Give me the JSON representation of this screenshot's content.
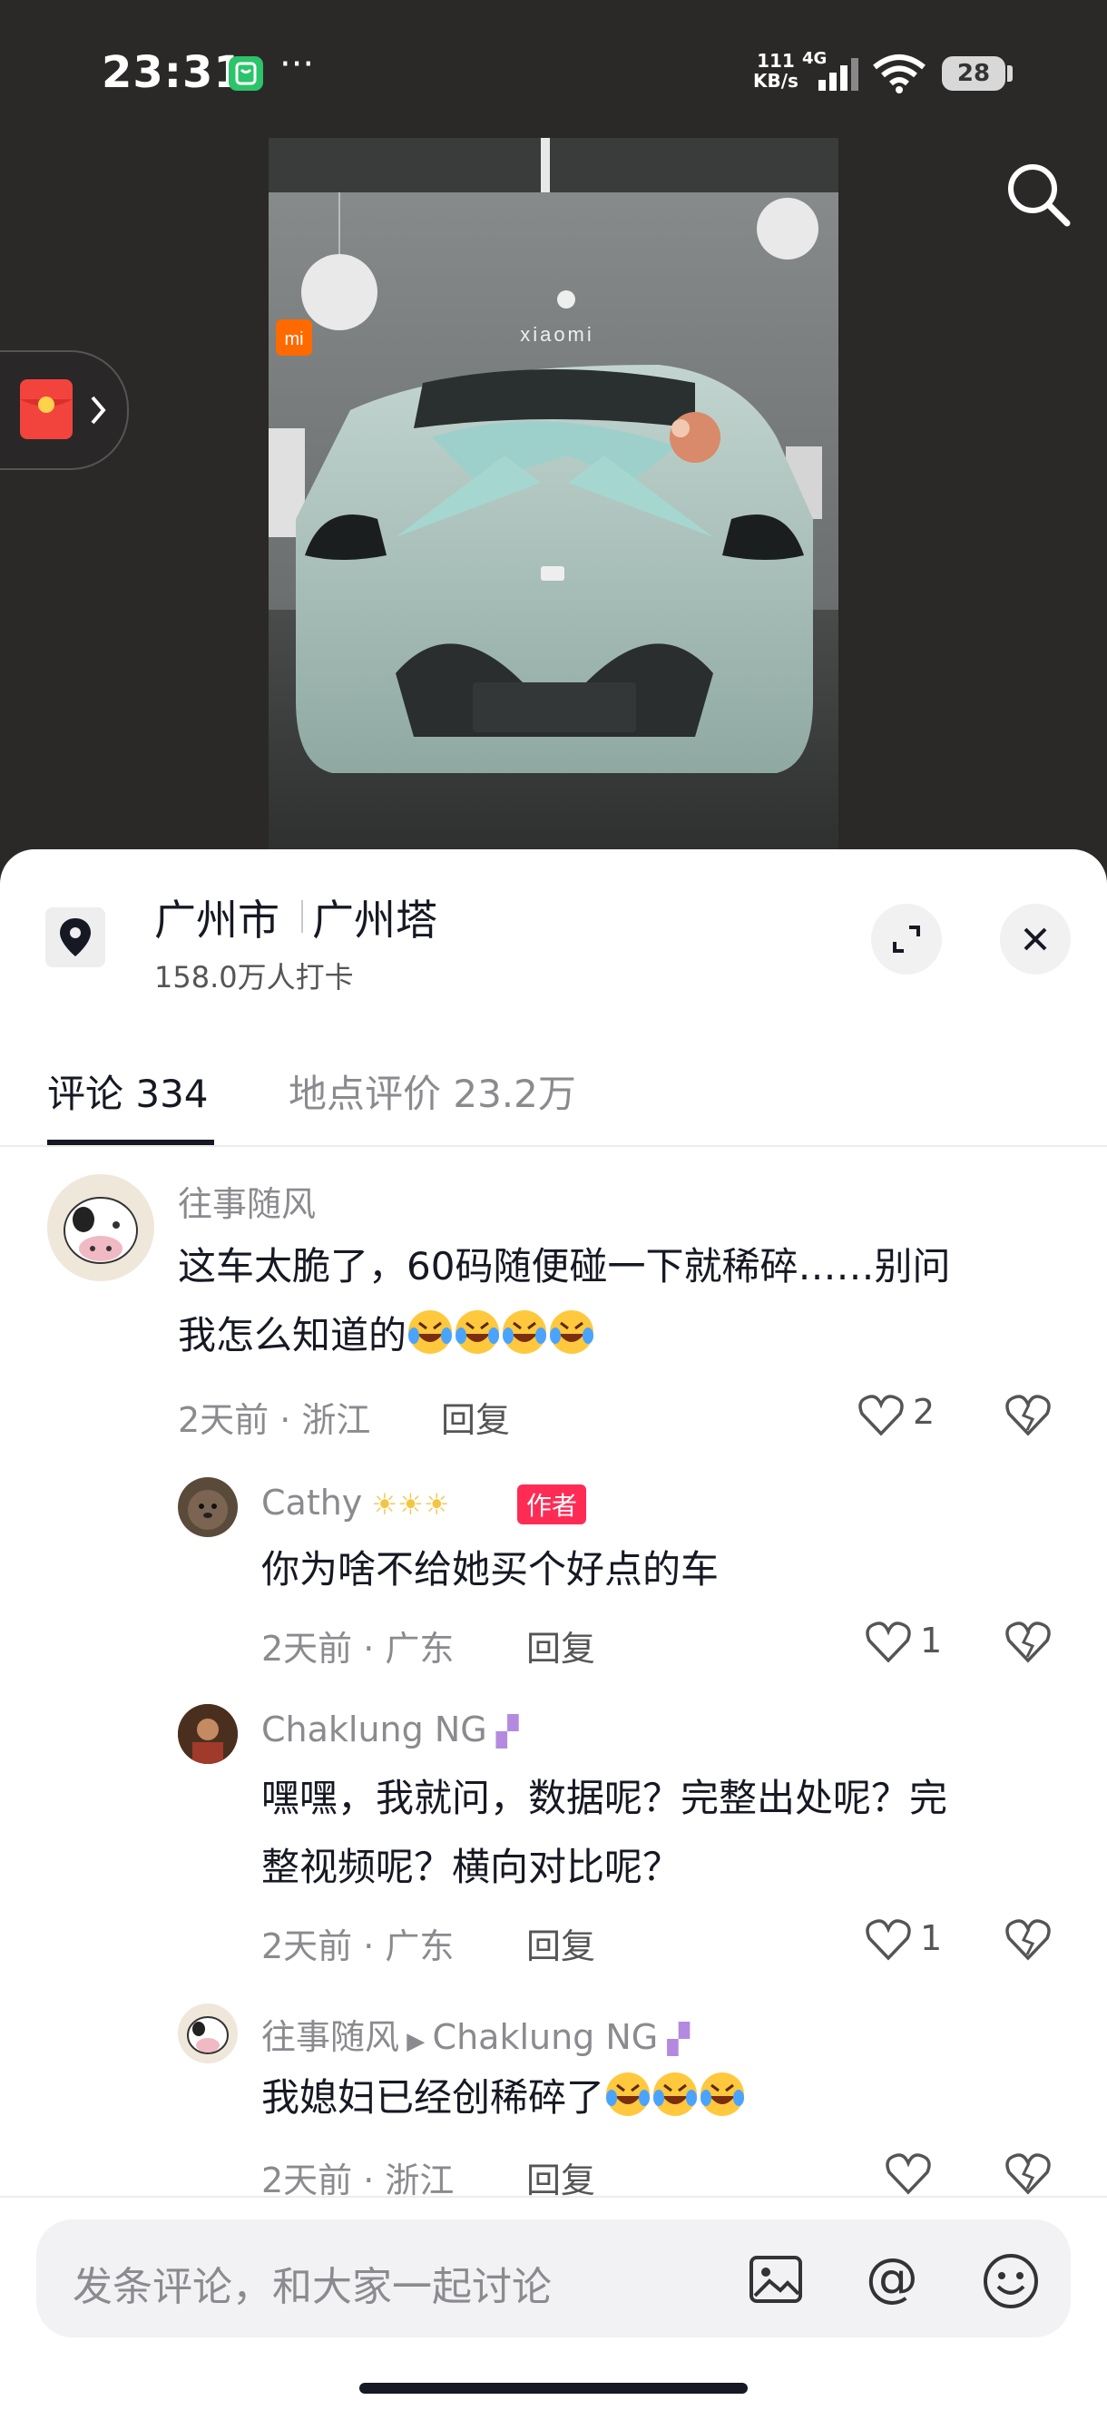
{
  "status_bar": {
    "time": "23:31",
    "more": "···",
    "net_speed_value": "111",
    "net_speed_unit": "KB/s",
    "network": "4G",
    "battery": "28"
  },
  "location": {
    "city": "广州市",
    "place": "广州塔",
    "checkins": "158.0万人打卡"
  },
  "tabs": [
    {
      "label": "评论 334",
      "active": true
    },
    {
      "label": "地点评价 23.2万",
      "active": false
    }
  ],
  "comments": [
    {
      "user": "往事随风",
      "text_line1": "这车太脆了，60码随便碰一下就稀碎……别问",
      "text_line2": "我怎么知道的",
      "emoji_count": 4,
      "meta": "2天前 · 浙江",
      "reply": "回复",
      "likes": "2"
    }
  ],
  "replies": [
    {
      "user": "Cathy",
      "badge": "作者",
      "text": "你为啥不给她买个好点的车",
      "meta": "2天前 · 广东",
      "reply": "回复",
      "likes": "1"
    },
    {
      "user": "Chaklung NG",
      "text_line1": "嘿嘿，我就问，数据呢？完整出处呢？完",
      "text_line2": "整视频呢？横向对比呢？",
      "meta": "2天前 · 广东",
      "reply": "回复",
      "likes": "1"
    },
    {
      "user": "往事随风",
      "reply_to": "Chaklung NG",
      "text": "我媳妇已经创稀碎了",
      "meta": "2天前 · 浙江",
      "reply": "回复",
      "likes": ""
    }
  ],
  "input": {
    "placeholder": "发条评论，和大家一起讨论"
  },
  "photo": {
    "brand_text": "xiaomi"
  },
  "colors": {
    "accent": "#fe2c55",
    "text_primary": "#161823",
    "text_secondary": "#8a8a8f",
    "car_body": "#9fb7b0"
  }
}
